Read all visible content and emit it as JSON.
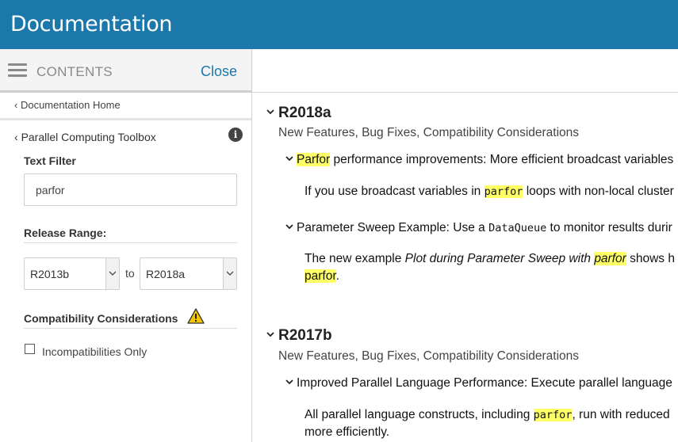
{
  "header": {
    "title": "Documentation"
  },
  "sidebar": {
    "contents_label": "CONTENTS",
    "close_label": "Close",
    "doc_home": "Documentation Home",
    "toolbox": "Parallel Computing Toolbox",
    "text_filter": {
      "label": "Text Filter",
      "value": "parfor"
    },
    "release_range": {
      "label": "Release Range:",
      "from": "R2013b",
      "to_word": "to",
      "to": "R2018a"
    },
    "compat": {
      "label": "Compatibility Considerations",
      "checkbox_label": "Incompatibilities Only",
      "checked": false
    }
  },
  "releases": [
    {
      "version": "R2018a",
      "subtitle": "New Features, Bug Fixes, Compatibility Considerations",
      "features": [
        {
          "title_hl": "Parfor",
          "title_rest": " performance improvements: More efficient broadcast variables",
          "para_pre": "If you use broadcast variables in ",
          "para_code": "parfor",
          "para_post": " loops with non-local cluster"
        },
        {
          "title_pre": "Parameter Sweep Example: Use a ",
          "title_code": "DataQueue",
          "title_post": " to monitor results durir",
          "para_pre": "The new example ",
          "para_italic_pre": "Plot during Parameter Sweep with ",
          "para_italic_hl": "parfor",
          "para_post": " shows h",
          "para_line2_hl": "parfor",
          "para_line2_post": "."
        }
      ]
    },
    {
      "version": "R2017b",
      "subtitle": "New Features, Bug Fixes, Compatibility Considerations",
      "features": [
        {
          "title": "Improved Parallel Language Performance: Execute parallel language",
          "para_pre": "All parallel language constructs, including ",
          "para_code": "parfor",
          "para_post": ", run with reduced",
          "para_line2": "more efficiently."
        }
      ]
    }
  ],
  "colors": {
    "header_bg": "#1c77aa",
    "link": "#1c77aa",
    "highlight": "#ffff66",
    "warning": "#f5c400"
  }
}
